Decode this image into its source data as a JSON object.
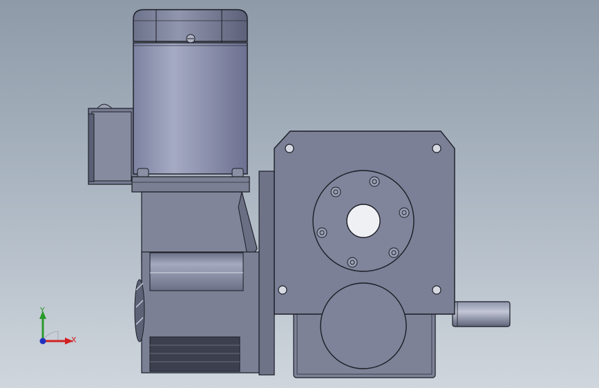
{
  "viewport": {
    "background_top": "#8e9aa8",
    "background_bottom": "#cfd6dd"
  },
  "model": {
    "description_icon": "gear-motor-assembly",
    "colors": {
      "body": "#7a7f92",
      "body_light": "#9aa0b4",
      "motor": "#8a90a8",
      "shadow": "#4a4e60",
      "outline": "#1a1c24"
    }
  },
  "triad": {
    "x_label": "X",
    "y_label": "Y",
    "x_color": "#d22020",
    "y_color": "#2a9a2a",
    "z_color": "#2030c0"
  }
}
